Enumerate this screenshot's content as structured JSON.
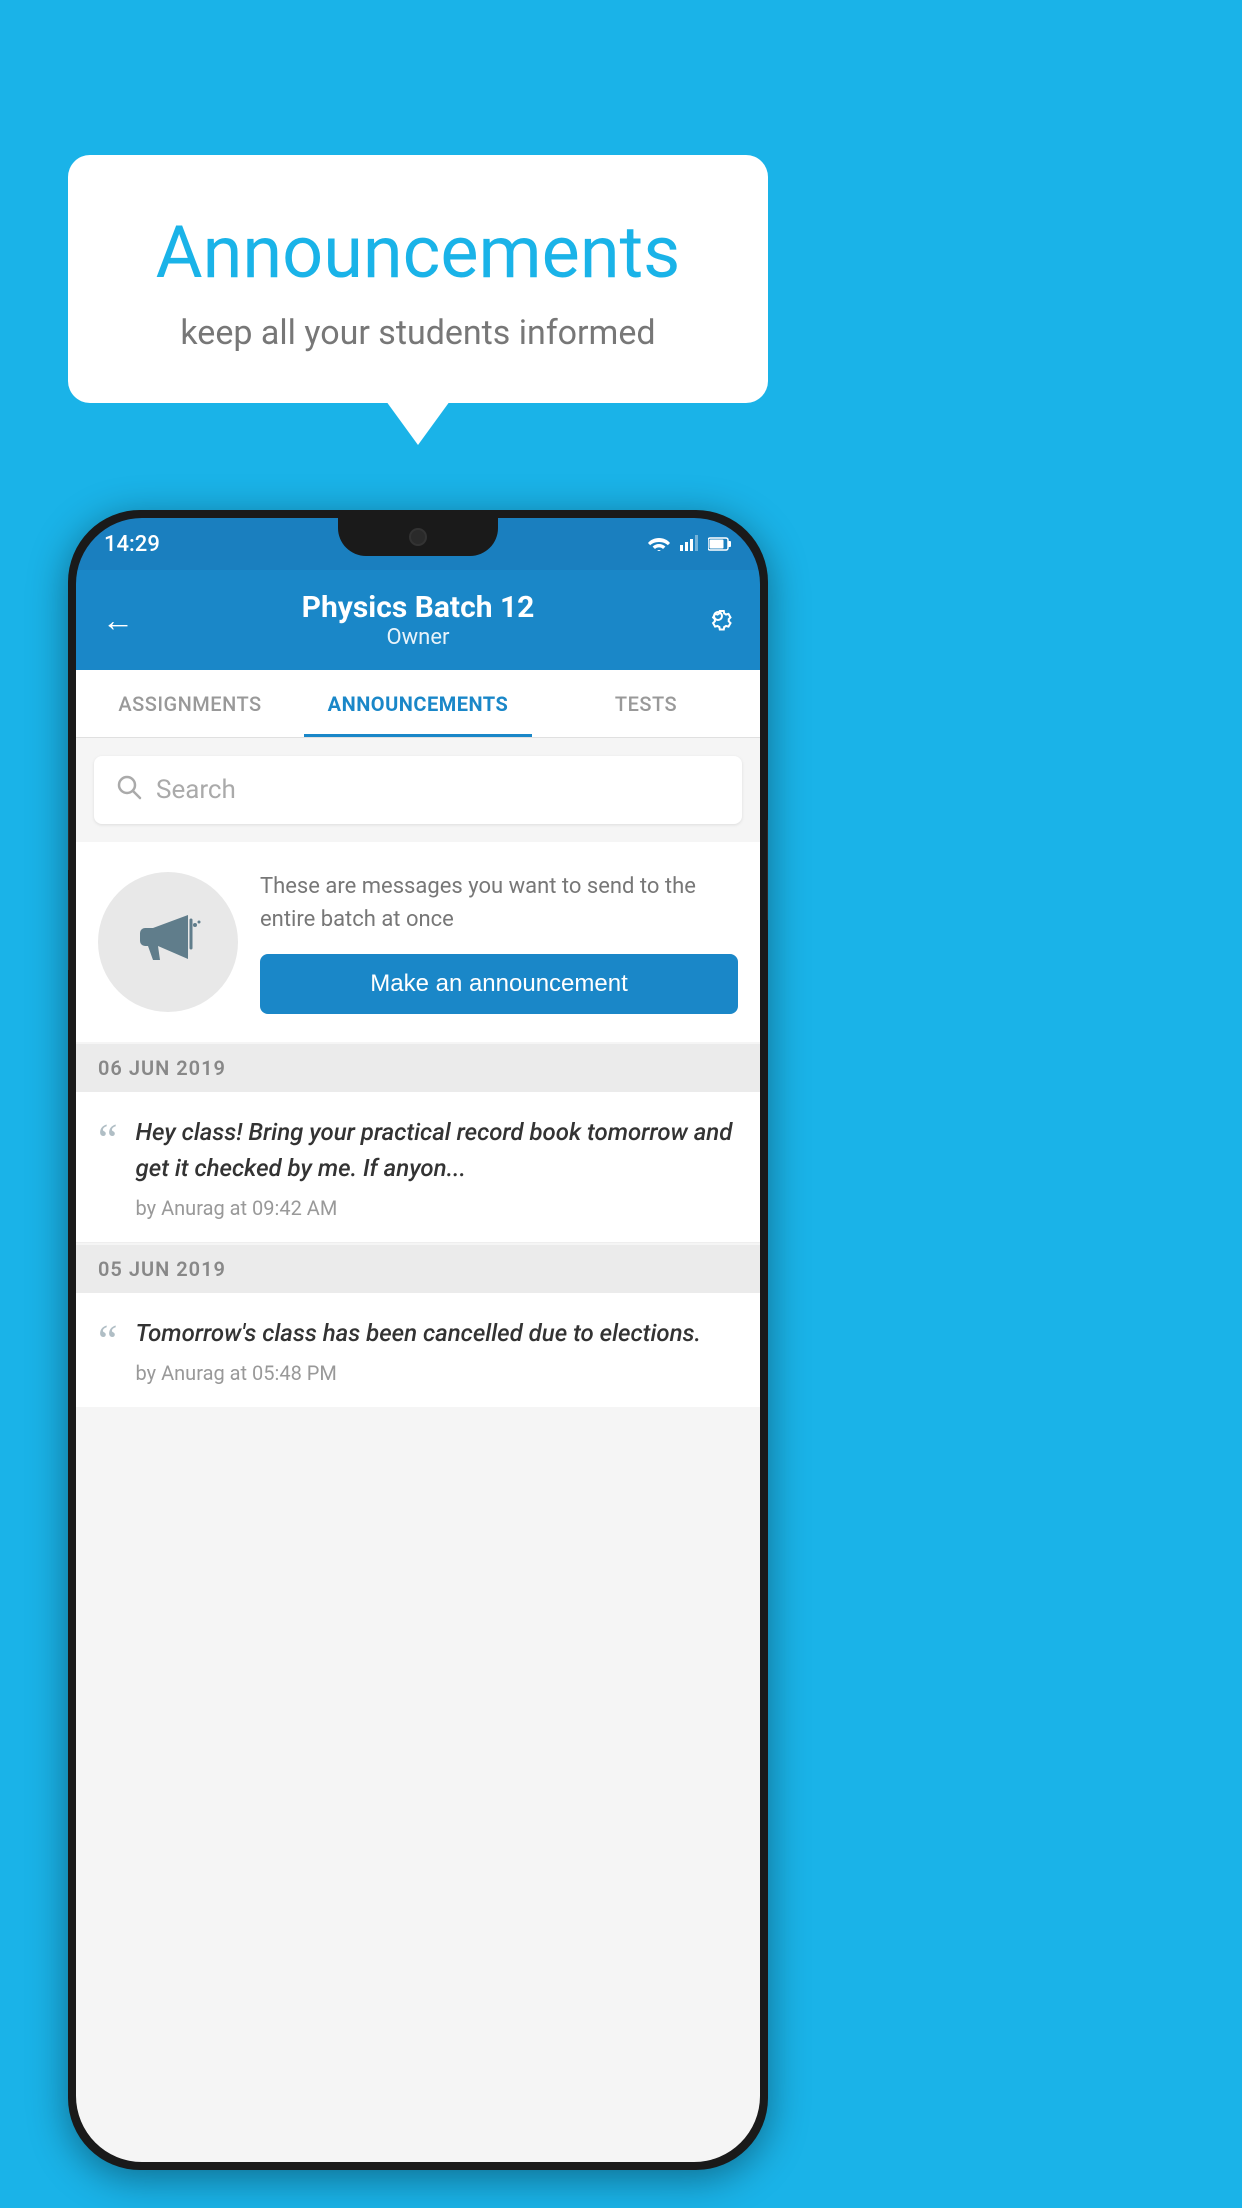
{
  "background_color": "#1ab3e8",
  "speech_bubble": {
    "title": "Announcements",
    "subtitle": "keep all your students informed"
  },
  "status_bar": {
    "time": "14:29",
    "wifi": "▼",
    "signal": "▲",
    "battery": "▌"
  },
  "header": {
    "title": "Physics Batch 12",
    "subtitle": "Owner",
    "back_label": "←"
  },
  "tabs": [
    {
      "label": "ASSIGNMENTS",
      "active": false
    },
    {
      "label": "ANNOUNCEMENTS",
      "active": true
    },
    {
      "label": "TESTS",
      "active": false
    },
    {
      "label": "•••",
      "active": false
    }
  ],
  "search": {
    "placeholder": "Search"
  },
  "promo": {
    "description": "These are messages you want to send to the entire batch at once",
    "button_label": "Make an announcement"
  },
  "announcements": [
    {
      "date": "06  JUN  2019",
      "text": "Hey class! Bring your practical record book tomorrow and get it checked by me. If anyon...",
      "meta": "by Anurag at 09:42 AM"
    },
    {
      "date": "05  JUN  2019",
      "text": "Tomorrow's class has been cancelled due to elections.",
      "meta": "by Anurag at 05:48 PM"
    }
  ]
}
